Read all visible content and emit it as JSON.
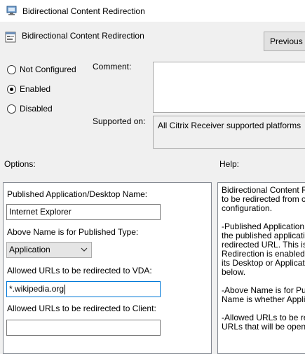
{
  "window": {
    "title": "Bidirectional Content Redirection"
  },
  "header": {
    "title": "Bidirectional Content Redirection",
    "previous_button": "Previous Setting"
  },
  "state": {
    "options": [
      "Not Configured",
      "Enabled",
      "Disabled"
    ],
    "selected": "Enabled"
  },
  "labels": {
    "comment": "Comment:",
    "supported_on": "Supported on:",
    "options": "Options:",
    "help": "Help:"
  },
  "supported_on_value": "All Citrix Receiver supported platforms",
  "options_pane": {
    "name_label": "Published Application/Desktop Name:",
    "name_value": "Internet Explorer",
    "type_label": "Above Name is for Published Type:",
    "type_value": "Application",
    "vda_label": "Allowed URLs to be redirected to VDA:",
    "vda_value": "*.wikipedia.org",
    "client_label": "Allowed URLs to be redirected to Client:",
    "client_value": ""
  },
  "help_text": "Bidirectional Content Re\nto be redirected from c\nconfiguration.\n\n-Published Application\nthe published applicati\nredirected URL. This is \nRedirection is enabled \nits Desktop or Applicat\nbelow.\n\n-Above Name is for Pu\nName is whether Appli\n\n-Allowed URLs to be re\nURLs that will be opene"
}
